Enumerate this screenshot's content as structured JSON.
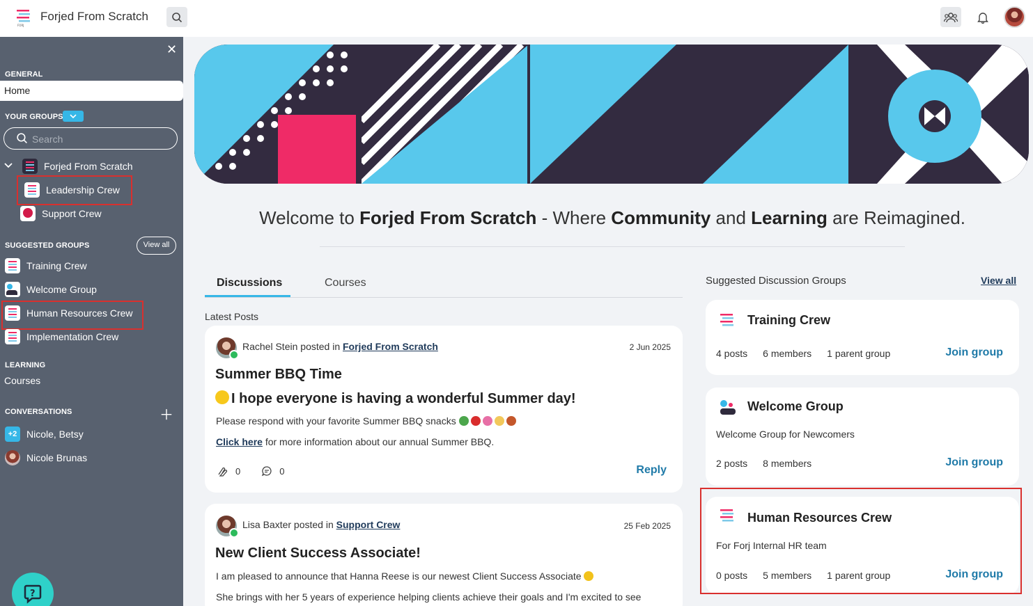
{
  "app": {
    "title": "Forjed From Scratch"
  },
  "topbar": {
    "search_icon": "search-icon",
    "groups_icon": "groups-icon",
    "bell_icon": "bell-icon",
    "avatar": "user-avatar"
  },
  "sidebar": {
    "general_heading": "GENERAL",
    "home_label": "Home",
    "your_groups_heading": "YOUR GROUPS",
    "search_placeholder": "Search",
    "groups": [
      {
        "label": "Forjed From Scratch"
      },
      {
        "label": "Leadership Crew"
      },
      {
        "label": "Support Crew"
      }
    ],
    "suggested_heading": "SUGGESTED GROUPS",
    "view_all": "View all",
    "suggested": [
      {
        "label": "Training Crew"
      },
      {
        "label": "Welcome Group"
      },
      {
        "label": "Human Resources Crew"
      },
      {
        "label": "Implementation Crew"
      }
    ],
    "learning_heading": "LEARNING",
    "courses_label": "Courses",
    "conversations_heading": "CONVERSATIONS",
    "conversations": [
      {
        "badge": "+2",
        "label": "Nicole, Betsy"
      },
      {
        "label": "Nicole Brunas"
      }
    ]
  },
  "welcome": {
    "pre": "Welcome to ",
    "name": "Forjed From Scratch",
    "mid1": " - Where ",
    "w1": "Community",
    "mid2": " and ",
    "w2": "Learning",
    "post": " are Reimagined."
  },
  "tabs": {
    "discussions": "Discussions",
    "courses": "Courses"
  },
  "latest_posts_label": "Latest Posts",
  "posts": [
    {
      "author": "Rachel Stein",
      "posted_in_text": " posted in ",
      "group": "Forjed From Scratch",
      "date": "2 Jun 2025",
      "title": "Summer BBQ Time",
      "subtitle": "I hope everyone is having a wonderful Summer day!",
      "line1": "Please respond with your favorite Summer BBQ snacks",
      "link": "Click here",
      "line2_rest": " for more information about our annual Summer BBQ.",
      "claps": "0",
      "comments": "0",
      "reply": "Reply"
    },
    {
      "author": "Lisa Baxter",
      "posted_in_text": " posted in ",
      "group": "Support Crew",
      "date": "25 Feb 2025",
      "title": "New Client Success Associate!",
      "line1": "I am pleased to announce that Hanna Reese is our newest Client Success Associate",
      "line2": "She brings with her 5 years of experience helping clients achieve their goals and I'm excited to see"
    }
  ],
  "suggested_groups": {
    "title": "Suggested Discussion Groups",
    "view_all": "View all",
    "cards": [
      {
        "name": "Training Crew",
        "posts": "4 posts",
        "members": "6 members",
        "parent": "1 parent group",
        "join": "Join group"
      },
      {
        "name": "Welcome Group",
        "desc": "Welcome Group for Newcomers",
        "posts": "2 posts",
        "members": "8 members",
        "join": "Join group"
      },
      {
        "name": "Human Resources Crew",
        "desc": "For Forj Internal HR team",
        "posts": "0 posts",
        "members": "5 members",
        "parent": "1 parent group",
        "join": "Join group"
      }
    ]
  },
  "colors": {
    "sidebar_bg": "#58616f",
    "accent": "#36b7e7",
    "brand_pink": "#ef2b67",
    "highlight_red": "#d9302e",
    "link_blue": "#1f7aa8"
  }
}
